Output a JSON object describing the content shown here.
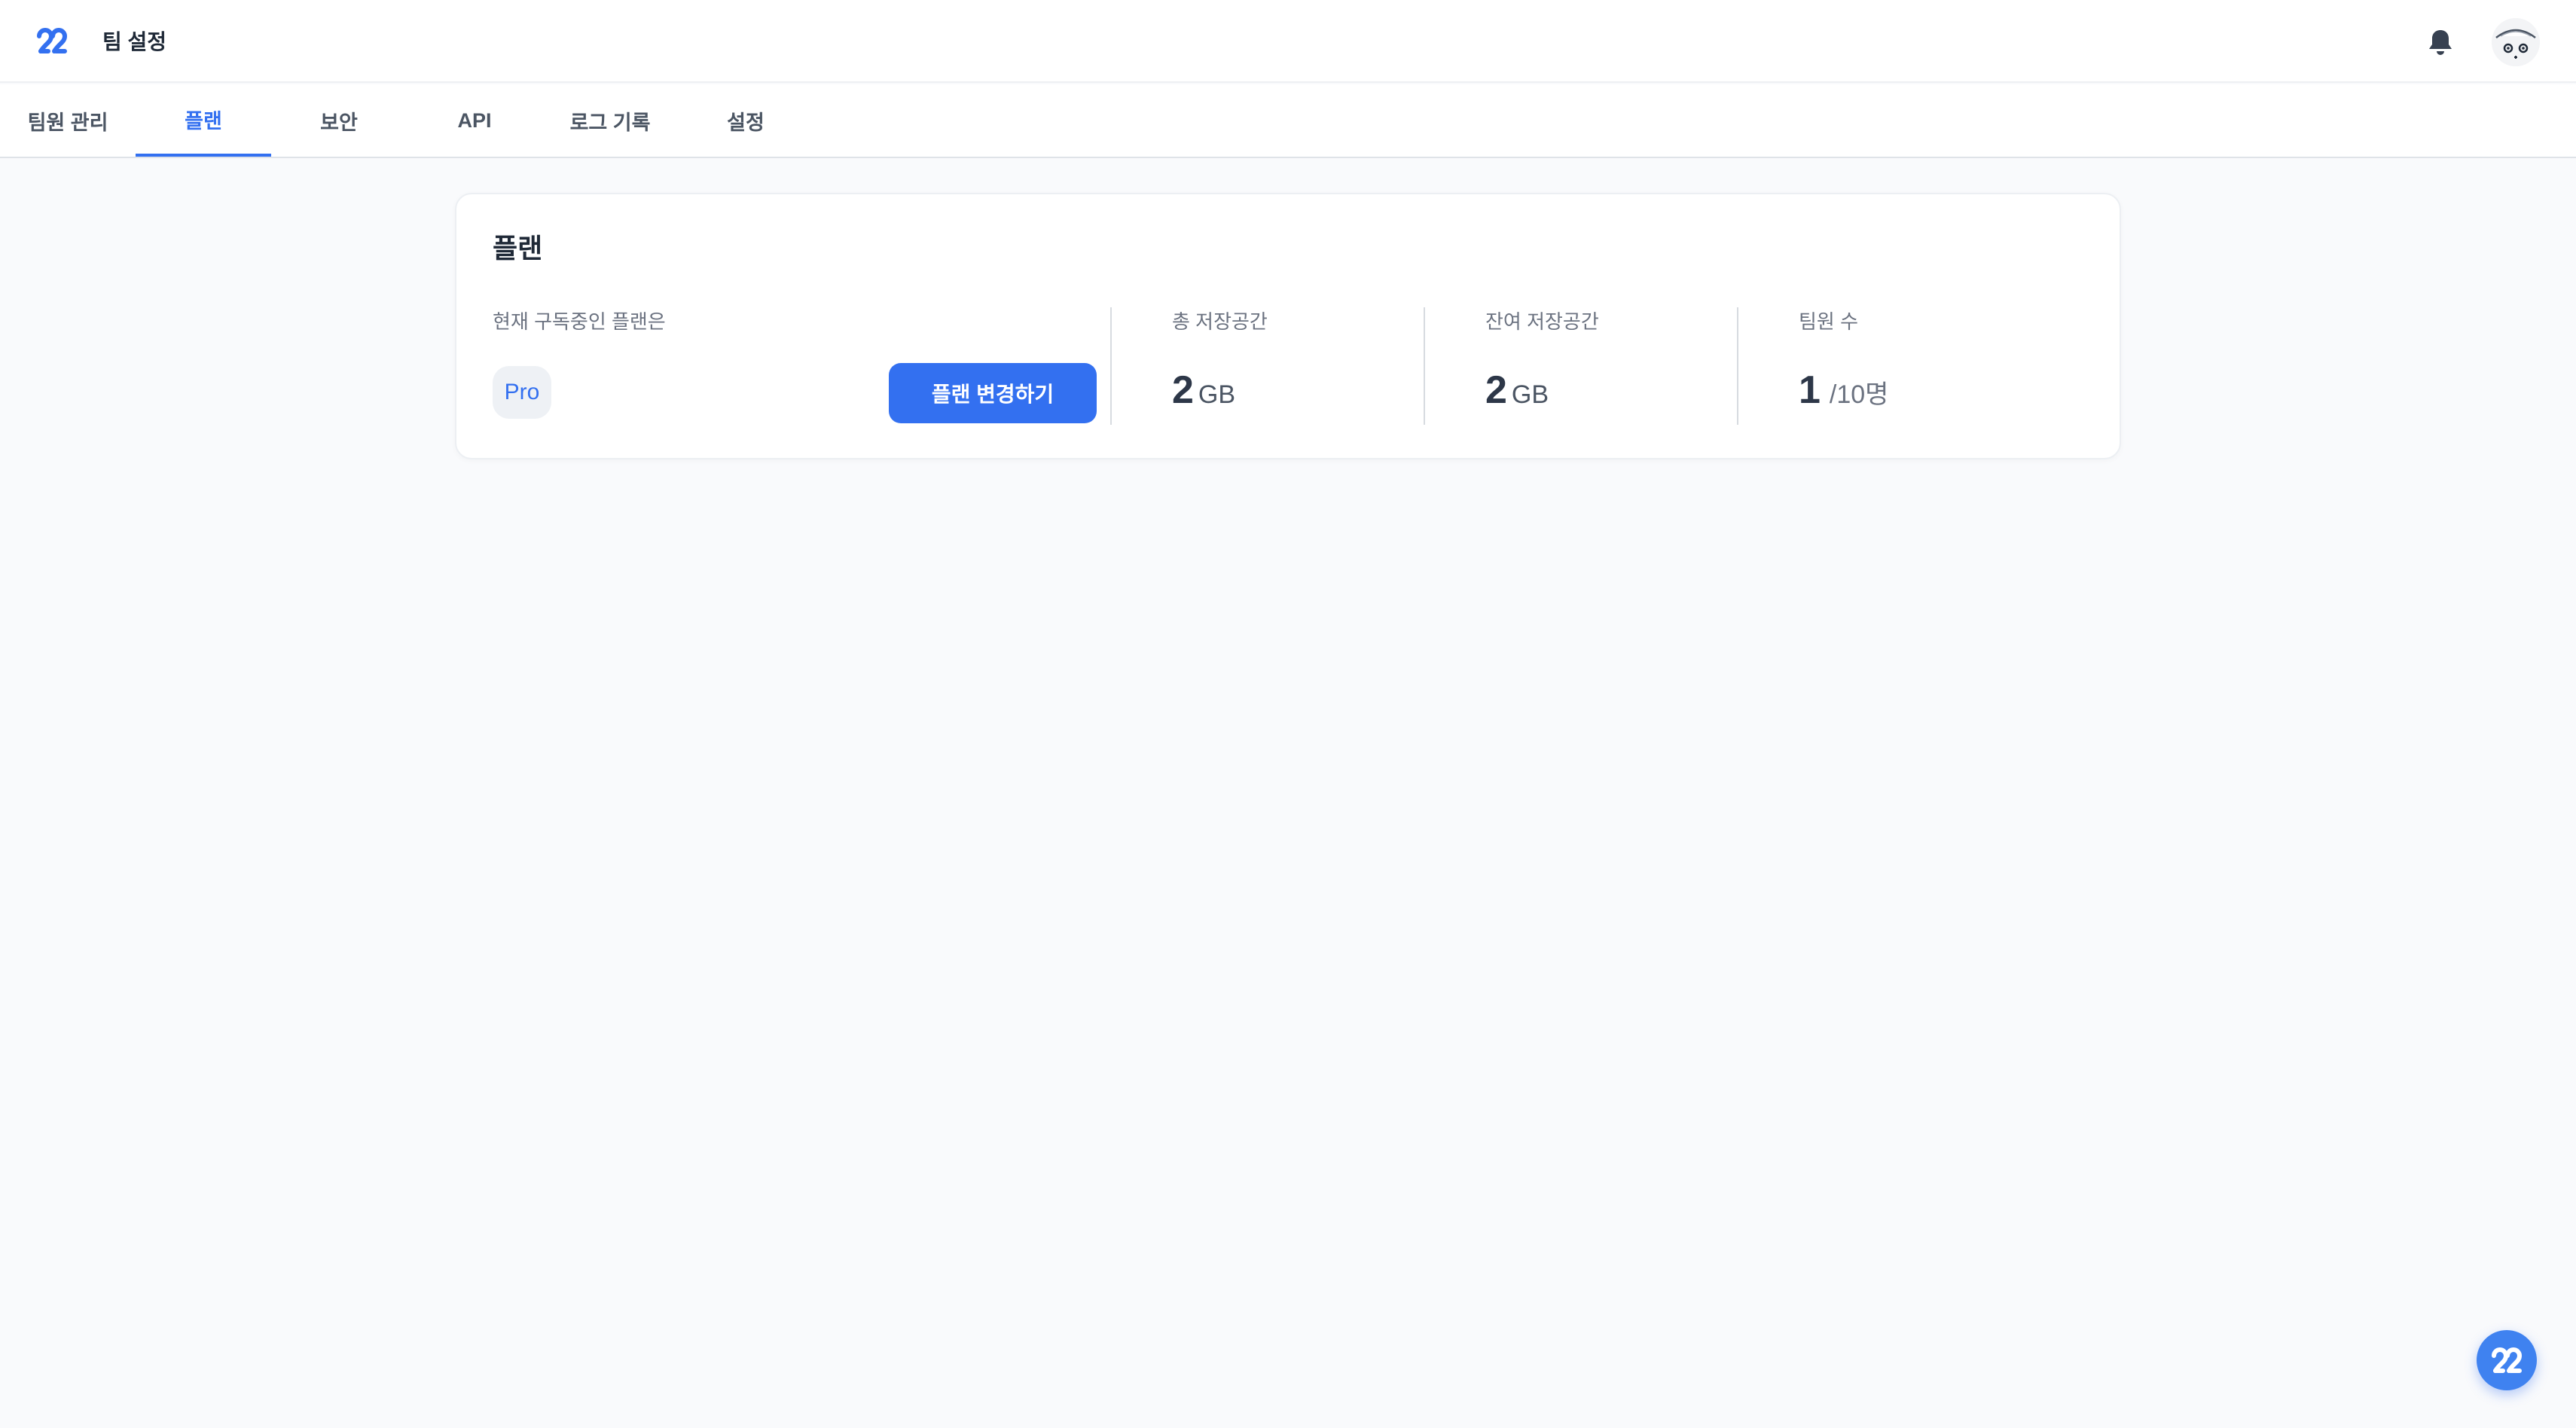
{
  "header": {
    "title": "팀 설정",
    "logo_icon": "app-logo-icon",
    "notification_icon": "bell-icon",
    "avatar_icon": "user-avatar"
  },
  "tabs": [
    {
      "label": "팀원 관리",
      "active": false
    },
    {
      "label": "플랜",
      "active": true
    },
    {
      "label": "보안",
      "active": false
    },
    {
      "label": "API",
      "active": false
    },
    {
      "label": "로그 기록",
      "active": false
    },
    {
      "label": "설정",
      "active": false
    }
  ],
  "plan": {
    "title": "플랜",
    "current_label": "현재 구독중인 플랜은",
    "current_plan": "Pro",
    "change_button": "플랜 변경하기",
    "total_storage": {
      "label": "총 저장공간",
      "value": "2",
      "unit": "GB"
    },
    "remaining_storage": {
      "label": "잔여 저장공간",
      "value": "2",
      "unit": "GB"
    },
    "members": {
      "label": "팀원 수",
      "value": "1",
      "unit": "/10명"
    }
  },
  "colors": {
    "accent": "#3370f0",
    "background": "#f9fafc",
    "card": "#ffffff"
  },
  "fab_icon": "app-logo-icon"
}
